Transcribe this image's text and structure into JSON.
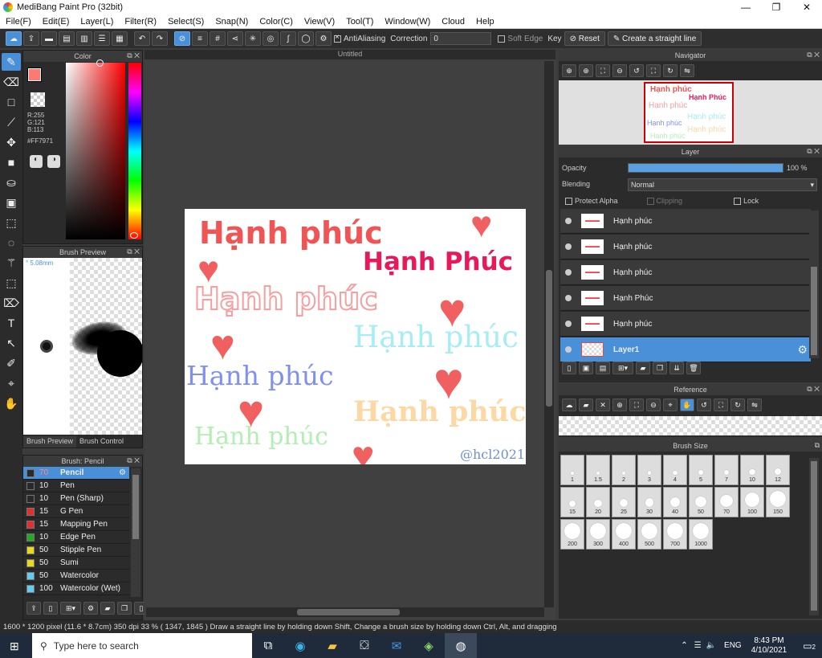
{
  "window": {
    "title": "MediBang Paint Pro (32bit)",
    "min": "—",
    "max": "❐",
    "close": "✕"
  },
  "menu": [
    "File(F)",
    "Edit(E)",
    "Layer(L)",
    "Filter(R)",
    "Select(S)",
    "Snap(N)",
    "Color(C)",
    "View(V)",
    "Tool(T)",
    "Window(W)",
    "Cloud",
    "Help"
  ],
  "toolbar": {
    "antialiasing": "AntiAliasing",
    "correction_label": "Correction",
    "correction_value": "0",
    "soft_edge": "Soft Edge",
    "key_label": "Key",
    "reset": "Reset",
    "straight_line": "Create a straight line"
  },
  "color": {
    "title": "Color",
    "primary": "#FF7971",
    "r": "R:255",
    "g": "G:121",
    "b": "B:113",
    "hex": "#FF7971"
  },
  "brush_preview": {
    "title": "Brush Preview",
    "size": "° 5.08mm",
    "tab1": "Brush Preview",
    "tab2": "Brush Control"
  },
  "brush_list": {
    "title": "Brush: Pencil",
    "items": [
      {
        "size": "70",
        "name": "Pencil",
        "color": "#2a2a2a"
      },
      {
        "size": "10",
        "name": "Pen",
        "color": "#2a2a2a"
      },
      {
        "size": "10",
        "name": "Pen (Sharp)",
        "color": "#2a2a2a"
      },
      {
        "size": "15",
        "name": "G Pen",
        "color": "#e03030"
      },
      {
        "size": "15",
        "name": "Mapping Pen",
        "color": "#e03030"
      },
      {
        "size": "10",
        "name": "Edge Pen",
        "color": "#22aa22"
      },
      {
        "size": "50",
        "name": "Stipple Pen",
        "color": "#e8d820"
      },
      {
        "size": "50",
        "name": "Sumi",
        "color": "#e8d820"
      },
      {
        "size": "50",
        "name": "Watercolor",
        "color": "#66ccee"
      },
      {
        "size": "100",
        "name": "Watercolor (Wet)",
        "color": "#66ccee"
      }
    ]
  },
  "canvas": {
    "tab": "Untitled",
    "texts": [
      {
        "text": "Hạnh phúc",
        "color": "#f05555"
      },
      {
        "text": "Hạnh Phúc",
        "color": "#e8185a"
      },
      {
        "text": "Hạnh phúc",
        "color": "#f4a0a0"
      },
      {
        "text": "Hạnh phúc",
        "color": "#a8ecf4"
      },
      {
        "text": "Hạnh phúc",
        "color": "#8090ee"
      },
      {
        "text": "Hạnh phúc",
        "color": "#fcd8a4"
      },
      {
        "text": "Hạnh phúc",
        "color": "#b4eeb4"
      }
    ],
    "credit": "@hcl2021"
  },
  "navigator": {
    "title": "Navigator"
  },
  "layer": {
    "title": "Layer",
    "opacity_label": "Opacity",
    "opacity_value": "100 %",
    "opacity_fraction": 1.0,
    "blending_label": "Blending",
    "blending_value": "Normal",
    "protect_alpha": "Protect Alpha",
    "clipping": "Clipping",
    "lock": "Lock",
    "items": [
      {
        "name": "Hạnh phúc"
      },
      {
        "name": "Hạnh phúc"
      },
      {
        "name": "Hạnh phúc"
      },
      {
        "name": "Hạnh Phúc"
      },
      {
        "name": "Hạnh phúc"
      },
      {
        "name": "Layer1"
      }
    ]
  },
  "reference": {
    "title": "Reference"
  },
  "brush_size": {
    "title": "Brush Size",
    "sizes": [
      "1",
      "1.5",
      "2",
      "3",
      "4",
      "5",
      "7",
      "10",
      "12",
      "15",
      "20",
      "25",
      "30",
      "40",
      "50",
      "70",
      "100",
      "150",
      "200",
      "300",
      "400",
      "500",
      "700",
      "1000"
    ]
  },
  "status": "1600 * 1200 pixel   (11.6 * 8.7cm)   350 dpi   33 %   ( 1347, 1845 )   Draw a straight line by holding down Shift, Change a brush size by holding down Ctrl, Alt, and dragging",
  "taskbar": {
    "search": "Type here to search",
    "lang": "ENG",
    "time": "8:43 PM",
    "date": "4/10/2021",
    "notif": "2"
  }
}
